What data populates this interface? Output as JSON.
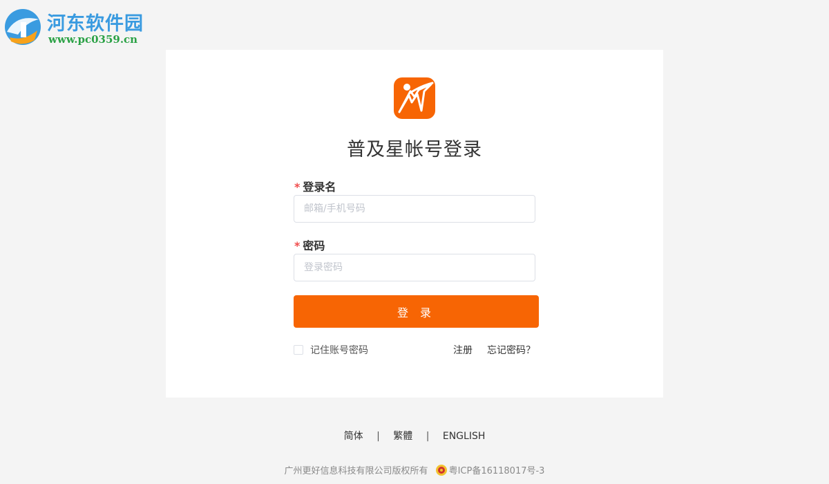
{
  "watermark": {
    "title": "河东软件园",
    "url": "www.pc0359.cn"
  },
  "login": {
    "title": "普及星帐号登录",
    "username": {
      "required_mark": "*",
      "label": "登录名",
      "placeholder": "邮箱/手机号码",
      "value": ""
    },
    "password": {
      "required_mark": "*",
      "label": "密码",
      "placeholder": "登录密码",
      "value": ""
    },
    "submit_label": "登 录",
    "remember_label": "记住账号密码",
    "remember_checked": false,
    "register_label": "注册",
    "forgot_label": "忘记密码？"
  },
  "footer": {
    "languages": [
      "简体",
      "繁體",
      "ENGLISH"
    ],
    "separator": "|",
    "copyright": "广州更好信息科技有限公司版权所有",
    "icp": "粤ICP备16118017号-3"
  },
  "colors": {
    "accent": "#f76504",
    "required": "#f04b4b",
    "background": "#f4f4f4",
    "card": "#ffffff"
  }
}
